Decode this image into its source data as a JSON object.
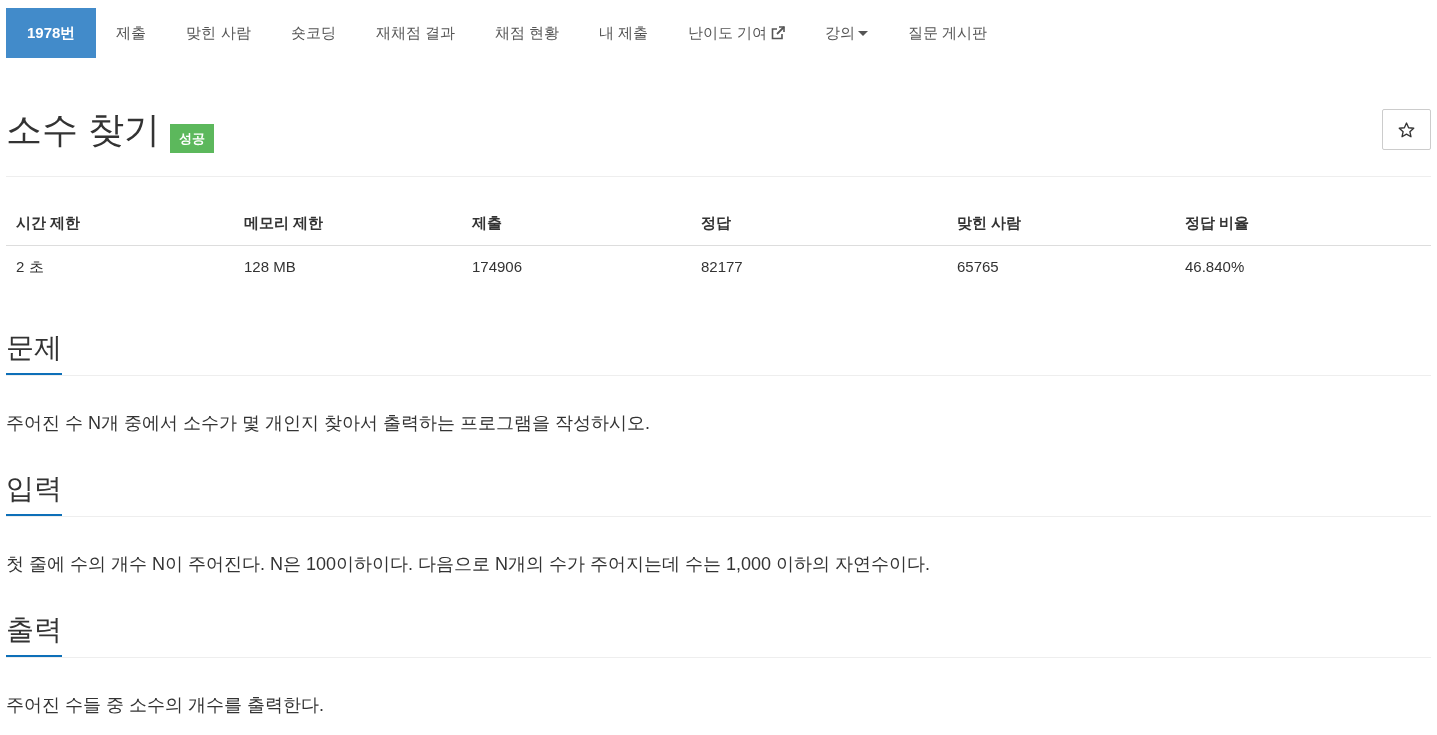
{
  "nav": {
    "tabs": [
      {
        "label": "1978번",
        "selected": true,
        "kind": "plain"
      },
      {
        "label": "제출",
        "selected": false,
        "kind": "plain"
      },
      {
        "label": "맞힌 사람",
        "selected": false,
        "kind": "plain"
      },
      {
        "label": "숏코딩",
        "selected": false,
        "kind": "plain"
      },
      {
        "label": "재채점 결과",
        "selected": false,
        "kind": "plain"
      },
      {
        "label": "채점 현황",
        "selected": false,
        "kind": "plain"
      },
      {
        "label": "내 제출",
        "selected": false,
        "kind": "plain"
      },
      {
        "label": "난이도 기여",
        "selected": false,
        "kind": "external"
      },
      {
        "label": "강의",
        "selected": false,
        "kind": "dropdown"
      },
      {
        "label": "질문 게시판",
        "selected": false,
        "kind": "plain"
      }
    ]
  },
  "problem": {
    "title": "소수 찾기",
    "badge": "성공"
  },
  "table": {
    "columns": [
      "시간 제한",
      "메모리 제한",
      "제출",
      "정답",
      "맞힌 사람",
      "정답 비율"
    ],
    "rows": [
      [
        "2 초",
        "128 MB",
        "174906",
        "82177",
        "65765",
        "46.840%"
      ]
    ]
  },
  "sections": [
    {
      "heading": "문제",
      "text": "주어진 수 N개 중에서 소수가 몇 개인지 찾아서 출력하는 프로그램을 작성하시오."
    },
    {
      "heading": "입력",
      "text": "첫 줄에 수의 개수 N이 주어진다. N은 100이하이다. 다음으로 N개의 수가 주어지는데 수는 1,000 이하의 자연수이다."
    },
    {
      "heading": "출력",
      "text": "주어진 수들 중 소수의 개수를 출력한다."
    }
  ]
}
